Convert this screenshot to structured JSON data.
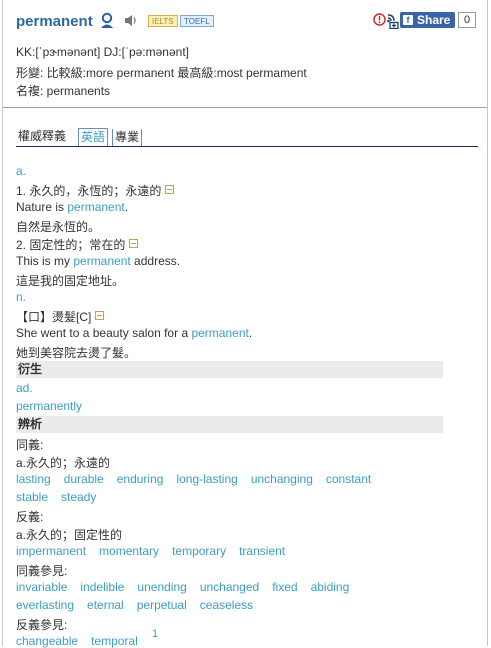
{
  "header": {
    "word": "permanent",
    "tag_ielts": "IELTS",
    "tag_toefl": "TOEFL",
    "share_label": "Share",
    "share_count": "0",
    "pron": "KK:[ˈpɝmənənt] DJ:[ˈpə:mənənt]",
    "forms": "形變: 比較級:more permanent  最高級:most permament",
    "plural": "名複: permanents"
  },
  "tabs": [
    "權威釋義",
    "英語",
    "專業"
  ],
  "defs": {
    "pos1": "a.",
    "sense1": "1. 永久的，永恆的；永遠的",
    "ex1_pre": "Nature is ",
    "ex1_word": "permanent",
    "ex1_post": ".",
    "ex1_tr": "自然是永恆的。",
    "sense2": "2. 固定性的；常在的",
    "ex2_pre": "This is my ",
    "ex2_word": "permanent",
    "ex2_post": " address.",
    "ex2_tr": "這是我的固定地址。",
    "pos2": "n.",
    "sense3": "【口】燙髮[C]",
    "ex3_pre": "She went to a beauty salon for a ",
    "ex3_word": "permanent",
    "ex3_post": ".",
    "ex3_tr": "她到美容院去燙了髮。"
  },
  "derived": {
    "title": "衍生",
    "pos": "ad.",
    "word": "permanently"
  },
  "analysis": {
    "title": "辨析",
    "syn_label": "同義:",
    "syn_sense": "a.永久的；永遠的",
    "syn_words_1": [
      "lasting",
      "durable",
      "enduring",
      "long-lasting",
      "unchanging",
      "constant"
    ],
    "syn_words_2": [
      "stable",
      "steady"
    ],
    "ant_label": "反義:",
    "ant_sense": "a.永久的；固定性的",
    "ant_words": [
      "impermanent",
      "momentary",
      "temporary",
      "transient"
    ],
    "syn_ref_label": "同義參見:",
    "syn_ref_words_1": [
      "invariable",
      "indelible",
      "unending",
      "unchanged",
      "fixed",
      "abiding"
    ],
    "syn_ref_words_2": [
      "everlasting",
      "eternal",
      "perpetual",
      "ceaseless"
    ],
    "ant_ref_label": "反義參見:",
    "ant_ref_words": [
      "changeable",
      "temporal"
    ],
    "footnote": "1"
  }
}
